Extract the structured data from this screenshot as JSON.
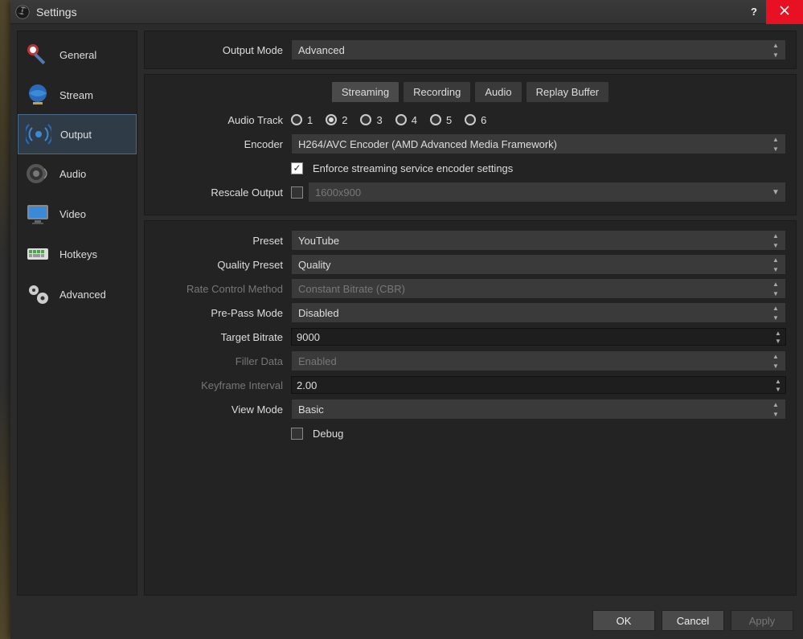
{
  "title": "Settings",
  "sidebar": [
    {
      "label": "General"
    },
    {
      "label": "Stream"
    },
    {
      "label": "Output"
    },
    {
      "label": "Audio"
    },
    {
      "label": "Video"
    },
    {
      "label": "Hotkeys"
    },
    {
      "label": "Advanced"
    }
  ],
  "outputMode": {
    "label": "Output Mode",
    "value": "Advanced"
  },
  "tabs": [
    "Streaming",
    "Recording",
    "Audio",
    "Replay Buffer"
  ],
  "audioTrack": {
    "label": "Audio Track",
    "options": [
      "1",
      "2",
      "3",
      "4",
      "5",
      "6"
    ],
    "selected": "2"
  },
  "encoder": {
    "label": "Encoder",
    "value": "H264/AVC Encoder (AMD Advanced Media Framework)"
  },
  "enforce": {
    "label": "Enforce streaming service encoder settings",
    "checked": true
  },
  "rescale": {
    "label": "Rescale Output",
    "checked": false,
    "value": "1600x900"
  },
  "settings": {
    "preset": {
      "label": "Preset",
      "value": "YouTube"
    },
    "qualityPreset": {
      "label": "Quality Preset",
      "value": "Quality"
    },
    "rateControl": {
      "label": "Rate Control Method",
      "value": "Constant Bitrate (CBR)",
      "disabled": true
    },
    "prePass": {
      "label": "Pre-Pass Mode",
      "value": "Disabled"
    },
    "targetBitrate": {
      "label": "Target Bitrate",
      "value": "9000"
    },
    "fillerData": {
      "label": "Filler Data",
      "value": "Enabled",
      "disabled": true
    },
    "keyframeInterval": {
      "label": "Keyframe Interval",
      "value": "2.00"
    },
    "viewMode": {
      "label": "View Mode",
      "value": "Basic"
    },
    "debug": {
      "label": "Debug",
      "checked": false
    }
  },
  "buttons": {
    "ok": "OK",
    "cancel": "Cancel",
    "apply": "Apply"
  }
}
